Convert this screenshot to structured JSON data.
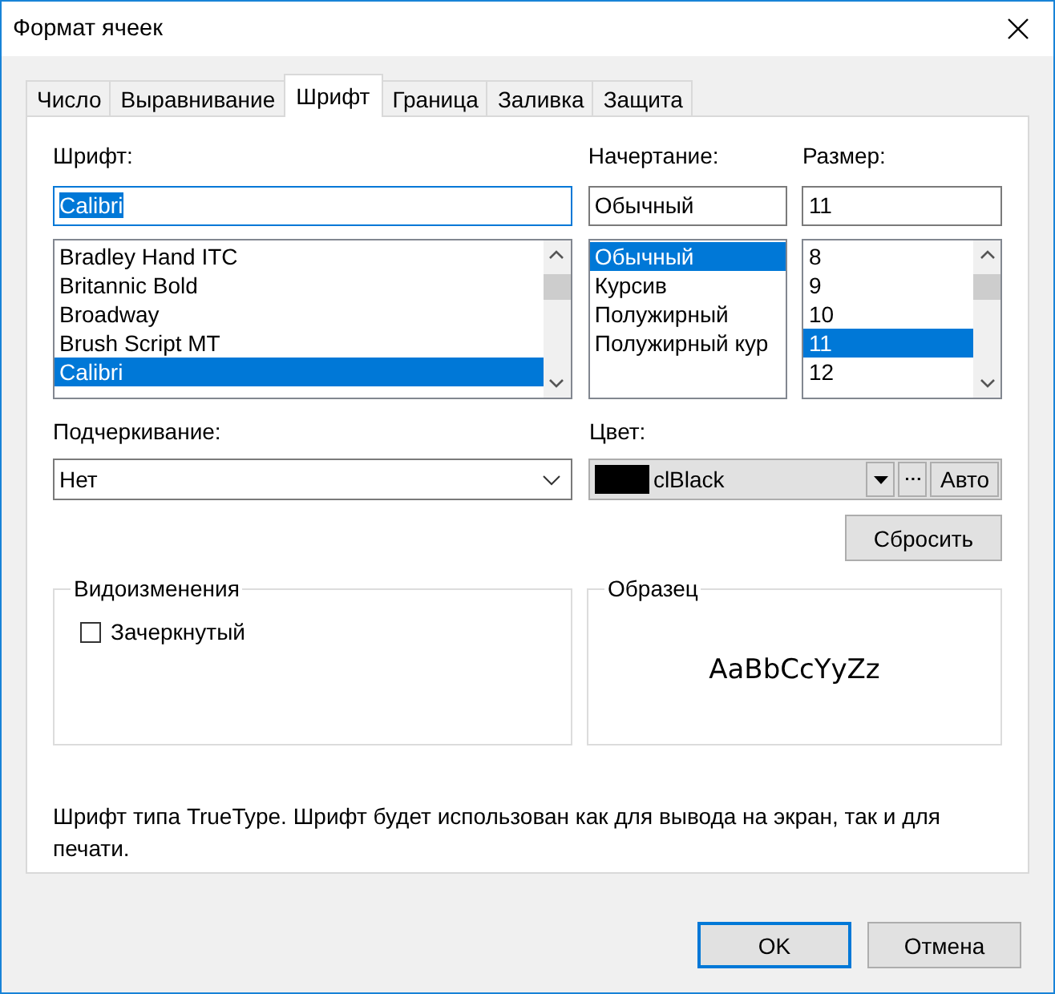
{
  "window": {
    "title": "Формат ячеек"
  },
  "tabs": [
    {
      "label": "Число",
      "selected": false
    },
    {
      "label": "Выравнивание",
      "selected": false
    },
    {
      "label": "Шрифт",
      "selected": true
    },
    {
      "label": "Граница",
      "selected": false
    },
    {
      "label": "Заливка",
      "selected": false
    },
    {
      "label": "Защита",
      "selected": false
    }
  ],
  "font": {
    "label": "Шрифт:",
    "value": "Calibri",
    "items": [
      {
        "name": "Bradley Hand ITC",
        "selected": false
      },
      {
        "name": "Britannic Bold",
        "selected": false
      },
      {
        "name": "Broadway",
        "selected": false
      },
      {
        "name": "Brush Script MT",
        "selected": false
      },
      {
        "name": "Calibri",
        "selected": true
      }
    ]
  },
  "style": {
    "label": "Начертание:",
    "value": "Обычный",
    "items": [
      {
        "name": "Обычный",
        "selected": true
      },
      {
        "name": "Курсив",
        "selected": false
      },
      {
        "name": "Полужирный",
        "selected": false
      },
      {
        "name": "Полужирный кур",
        "selected": false
      }
    ]
  },
  "size": {
    "label": "Размер:",
    "value": "11",
    "items": [
      {
        "name": "8",
        "selected": false
      },
      {
        "name": "9",
        "selected": false
      },
      {
        "name": "10",
        "selected": false
      },
      {
        "name": "11",
        "selected": true
      },
      {
        "name": "12",
        "selected": false
      }
    ]
  },
  "underline": {
    "label": "Подчеркивание:",
    "value": "Нет"
  },
  "color": {
    "label": "Цвет:",
    "value": "clBlack",
    "color": "#000000",
    "auto_button": "Авто"
  },
  "reset_button": "Сбросить",
  "effects": {
    "title": "Видоизменения",
    "options": [
      {
        "label": "Зачеркнутый",
        "checked": false
      }
    ]
  },
  "sample": {
    "title": "Образец",
    "text": "AaBbCcYyZz"
  },
  "note": "Шрифт типа TrueType. Шрифт будет использован как для вывода на экран, так и для печати.",
  "buttons": [
    {
      "label": "OK",
      "default": true
    },
    {
      "label": "Отмена",
      "default": false
    }
  ]
}
